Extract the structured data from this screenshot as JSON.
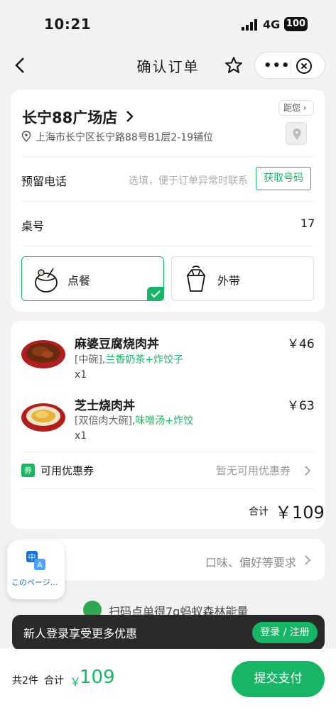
{
  "status": {
    "time": "10:21",
    "network": "4G",
    "battery": "100"
  },
  "nav": {
    "title": "确认订单"
  },
  "store": {
    "name": "长宁88广场店",
    "address": "上海市长宁区长宁路88号B1层2-19铺位",
    "distance_label": "距您 ›"
  },
  "phone": {
    "label": "预留电话",
    "placeholder": "选填，便于订单异常时联系",
    "button": "获取号码"
  },
  "table": {
    "label": "桌号",
    "value": "17"
  },
  "modes": [
    {
      "label": "点餐",
      "selected": true
    },
    {
      "label": "外带",
      "selected": false
    }
  ],
  "items": [
    {
      "name": "麻婆豆腐烧肉丼",
      "price": "￥46",
      "spec": "[中碗],",
      "extras": "兰香奶茶+炸饺子",
      "qty": "x1"
    },
    {
      "name": "芝士烧肉丼",
      "price": "￥63",
      "spec": "[双倍肉大碗],",
      "extras": "味噌汤+炸饺",
      "qty": "x1"
    }
  ],
  "coupon": {
    "icon": "券",
    "label": "可用优惠券",
    "status": "暂无可用优惠券"
  },
  "subtotal": {
    "label": "合计",
    "value": "￥109"
  },
  "preference": {
    "placeholder": "口味、偏好等要求"
  },
  "translate": {
    "label": "このページ…"
  },
  "energy": {
    "text": "扫码点单得7g蚂蚁森林能量"
  },
  "login_banner": {
    "text": "新人登录享受更多优惠",
    "button": "登录 / 注册"
  },
  "footer": {
    "count": "共2件",
    "total_label": "合计",
    "currency": "￥",
    "total": "109",
    "pay_button": "提交支付"
  },
  "colors": {
    "accent": "#18b566",
    "background": "#f2f2f2"
  }
}
